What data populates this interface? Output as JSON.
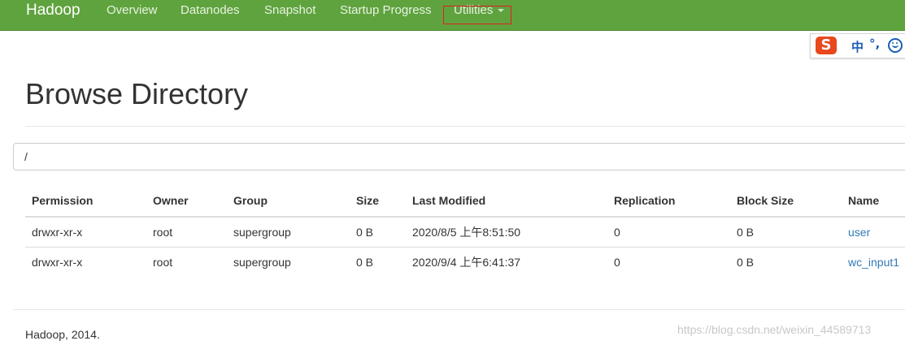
{
  "navbar": {
    "brand": "Hadoop",
    "items": [
      {
        "label": "Overview"
      },
      {
        "label": "Datanodes"
      },
      {
        "label": "Snapshot"
      },
      {
        "label": "Startup Progress"
      },
      {
        "label": "Utilities"
      }
    ]
  },
  "ime": {
    "logo": "S",
    "lang": "中",
    "punct": "°,"
  },
  "page": {
    "title": "Browse Directory"
  },
  "path_input": {
    "value": "/"
  },
  "table": {
    "headers": [
      "Permission",
      "Owner",
      "Group",
      "Size",
      "Last Modified",
      "Replication",
      "Block Size",
      "Name"
    ],
    "rows": [
      [
        "drwxr-xr-x",
        "root",
        "supergroup",
        "0 B",
        "2020/8/5 上午8:51:50",
        "0",
        "0 B",
        "user"
      ],
      [
        "drwxr-xr-x",
        "root",
        "supergroup",
        "0 B",
        "2020/9/4 上午6:41:37",
        "0",
        "0 B",
        "wc_input1"
      ]
    ]
  },
  "footer": {
    "text": "Hadoop, 2014."
  },
  "watermark": "https://blog.csdn.net/weixin_44589713",
  "colors": {
    "navbar": "#5fa33e",
    "link": "#337ab7",
    "highlight": "#e02020"
  }
}
